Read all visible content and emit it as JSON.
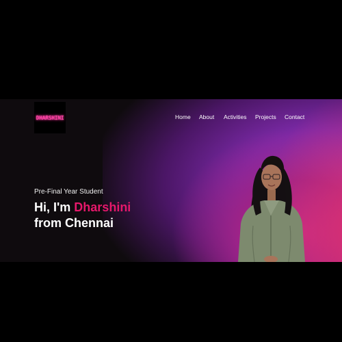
{
  "brand": {
    "logo_text": "DHARSHINI"
  },
  "nav": {
    "items": [
      {
        "label": "Home"
      },
      {
        "label": "About"
      },
      {
        "label": "Activities"
      },
      {
        "label": "Projects"
      },
      {
        "label": "Contact"
      }
    ]
  },
  "hero": {
    "subtitle": "Pre-Final Year Student",
    "greeting_prefix": "Hi, I'm ",
    "name": "Dharshini",
    "line2": "from Chennai"
  },
  "colors": {
    "accent": "#e6186b",
    "background": "#000000",
    "logo_glow": "#ff3fa3"
  }
}
